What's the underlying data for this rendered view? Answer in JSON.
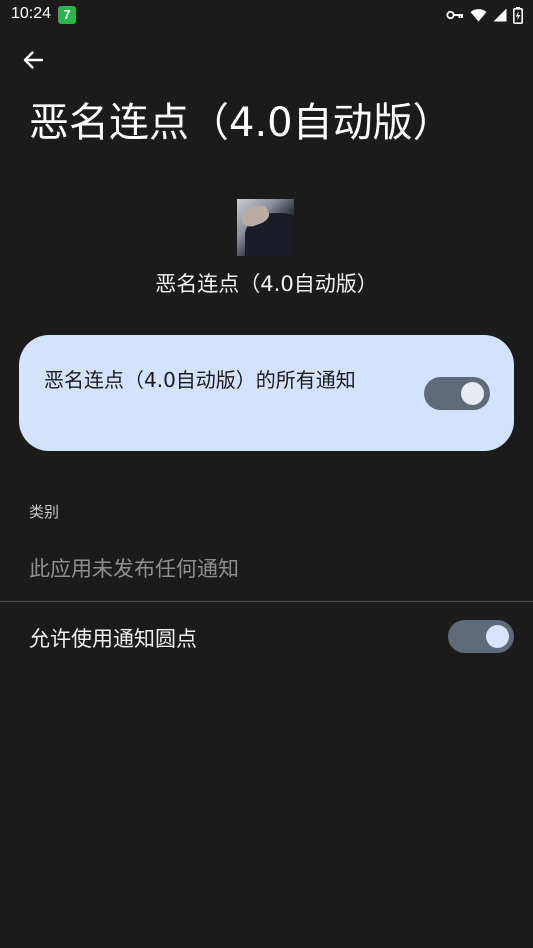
{
  "status_bar": {
    "time": "10:24",
    "app_badge": "7",
    "icons": [
      "vpn-key-icon",
      "wifi-icon",
      "signal-icon",
      "battery-icon"
    ]
  },
  "header": {
    "back_icon": "arrow-back-icon",
    "title": "恶名连点（4.0自动版）"
  },
  "app": {
    "name": "恶名连点（4.0自动版）"
  },
  "master_toggle": {
    "label": "恶名连点（4.0自动版）的所有通知",
    "enabled": true,
    "card_color": "#d3e3fd"
  },
  "categories": {
    "heading": "类别",
    "empty_message": "此应用未发布任何通知"
  },
  "notification_dots": {
    "label": "允许使用通知圆点",
    "enabled": true
  }
}
